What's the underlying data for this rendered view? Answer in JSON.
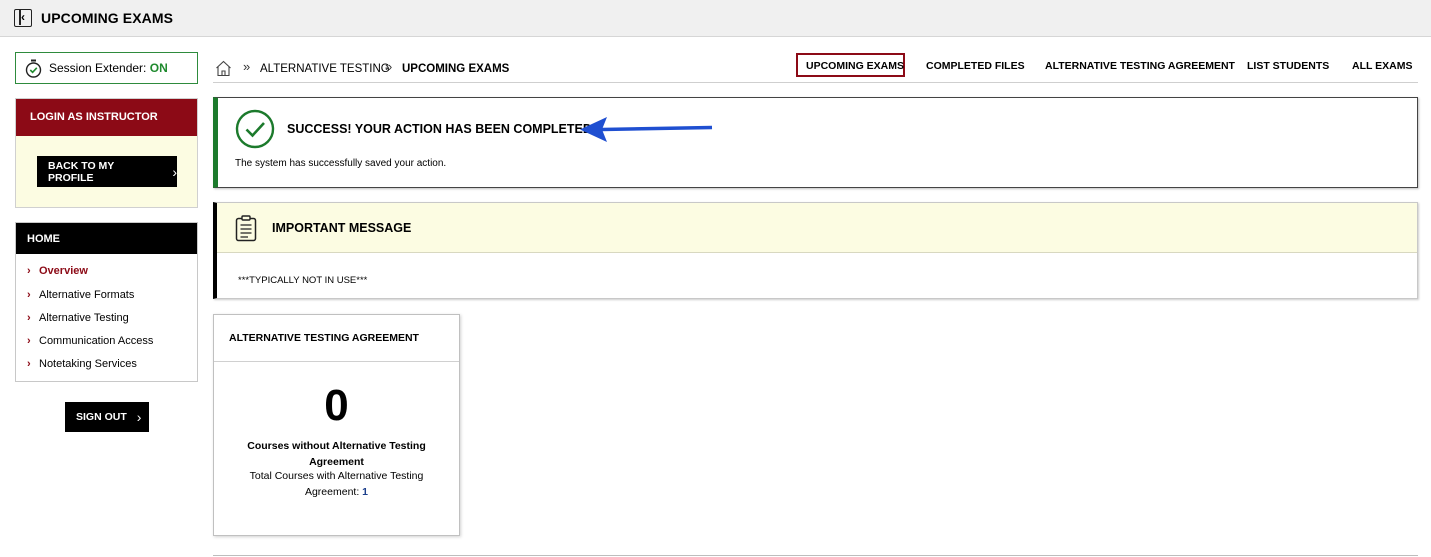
{
  "header": {
    "title": "UPCOMING EXAMS",
    "collapse_icon": "sidebar-collapse-icon"
  },
  "sidebar": {
    "session": {
      "label": "Session Extender:",
      "status": "ON",
      "icon": "stopwatch-check-icon",
      "status_color": "#1f8a2e"
    },
    "login": {
      "heading": "LOGIN AS INSTRUCTOR",
      "button": "BACK TO MY PROFILE"
    },
    "nav": {
      "heading": "HOME",
      "items": [
        {
          "label": "Overview",
          "active": true
        },
        {
          "label": "Alternative Formats",
          "active": false
        },
        {
          "label": "Alternative Testing",
          "active": false
        },
        {
          "label": "Communication Access",
          "active": false
        },
        {
          "label": "Notetaking Services",
          "active": false
        }
      ]
    },
    "sign_out": "SIGN OUT"
  },
  "breadcrumb": {
    "home_icon": "home-icon",
    "items": [
      "ALTERNATIVE TESTING",
      "UPCOMING EXAMS"
    ]
  },
  "tabs": [
    {
      "label": "UPCOMING EXAMS",
      "active": true
    },
    {
      "label": "COMPLETED FILES",
      "active": false
    },
    {
      "label": "ALTERNATIVE TESTING AGREEMENT",
      "active": false
    },
    {
      "label": "LIST STUDENTS",
      "active": false
    },
    {
      "label": "ALL EXAMS",
      "active": false
    }
  ],
  "success": {
    "title": "SUCCESS! YOUR ACTION HAS BEEN COMPLETED",
    "body": "The system has successfully saved your action.",
    "icon": "check-circle-icon",
    "color": "#1c7a2c",
    "annotation": "blue-arrow-icon"
  },
  "important": {
    "title": "IMPORTANT MESSAGE",
    "body": "***TYPICALLY NOT IN USE***",
    "icon": "clipboard-icon"
  },
  "card": {
    "title": "ALTERNATIVE TESTING AGREEMENT",
    "value": "0",
    "label": "Courses without Alternative Testing Agreement",
    "sub_label": "Total Courses with Alternative Testing Agreement:",
    "sub_value": "1"
  },
  "colors": {
    "brand": "#8c0a16",
    "accent_link": "#1c3f8c",
    "highlight_bg": "#fcfce2",
    "arrow": "#1f4fd1"
  }
}
